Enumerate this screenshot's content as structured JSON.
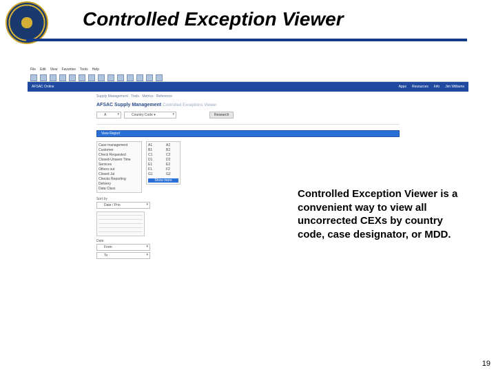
{
  "title": "Controlled Exception Viewer",
  "caption": "Controlled Exception Viewer is a convenient way to view all uncorrected CEXs by country code, case designator, or MDD.",
  "page_number": "19",
  "screenshot": {
    "menubar": [
      "File",
      "Edit",
      "View",
      "Favorites",
      "Tools",
      "Help"
    ],
    "brand": "AFSAC Online",
    "nav_right": [
      "Apps",
      "Resources",
      "Info",
      "Jim Williams"
    ],
    "crumbs": "Supply Management  ·  Tools  ·  Metrics  ·  Reference",
    "page_title": "AFSAC Supply Management",
    "page_subtitle": "Controlled Exceptions Viewer",
    "filter": {
      "label_a": "A",
      "country": "Country Code  ▾",
      "research_btn": "Research",
      "view_report_btn": "View Report"
    },
    "category_list": [
      "Case management",
      "Customer",
      "Check Requested",
      "Closed-Unseen Time",
      "Services",
      "Others out",
      "Closed Jul",
      "Checks Reporting",
      "Delivery",
      "Data Class"
    ],
    "code_pairs": [
      [
        "A1",
        "A2"
      ],
      [
        "B1",
        "B2"
      ],
      [
        "C1",
        "C2"
      ],
      [
        "D1",
        "D2"
      ],
      [
        "E1",
        "E2"
      ],
      [
        "F1",
        "F2"
      ],
      [
        "G1",
        "G2"
      ]
    ],
    "code_highlight": "Show more",
    "sort": {
      "label": "Sort by",
      "value": "Date / Prio"
    },
    "date": {
      "label": "Date",
      "from": "From",
      "to": "To"
    }
  }
}
